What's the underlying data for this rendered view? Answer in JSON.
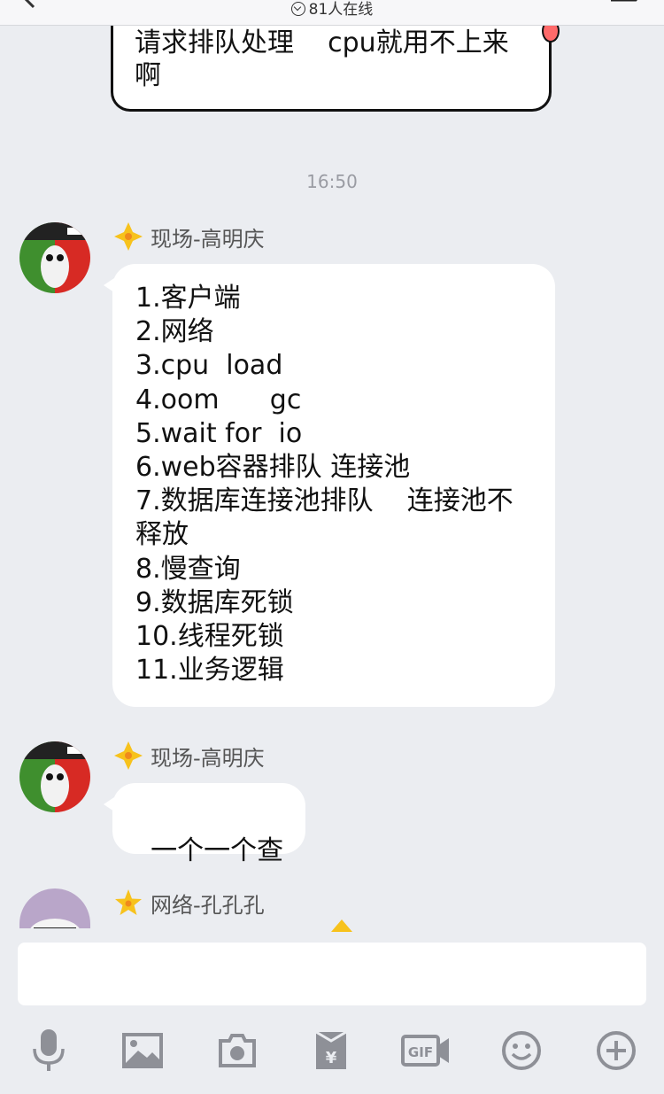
{
  "header": {
    "online_count": "81人在线"
  },
  "previous_message": {
    "text": "请求排队处理    cpu就用不上来\n啊"
  },
  "timestamp": "16:50",
  "messages": [
    {
      "sender": "现场-高明庆",
      "lines": [
        "1.客户端",
        "2.网络",
        "3.cpu  load",
        "4.oom      gc",
        "5.wait for  io",
        "6.web容器排队 连接池",
        "7.数据库连接池排队    连接池不",
        "释放",
        "8.慢查询",
        "9.数据库死锁",
        "10.线程死锁",
        "11.业务逻辑"
      ]
    },
    {
      "sender": "现场-高明庆",
      "text": "一个一个查"
    },
    {
      "sender": "网络-孔孔孔"
    }
  ],
  "input": {
    "value": "",
    "placeholder": ""
  },
  "toolbar": {
    "icons": [
      "microphone-icon",
      "image-icon",
      "camera-icon",
      "red-packet-icon",
      "gif-icon",
      "emoji-icon",
      "plus-icon"
    ]
  },
  "colors": {
    "background": "#ebedf1",
    "bubble": "#ffffff",
    "badge_gold": "#f7c21c",
    "icon_gray": "#8e9097"
  }
}
